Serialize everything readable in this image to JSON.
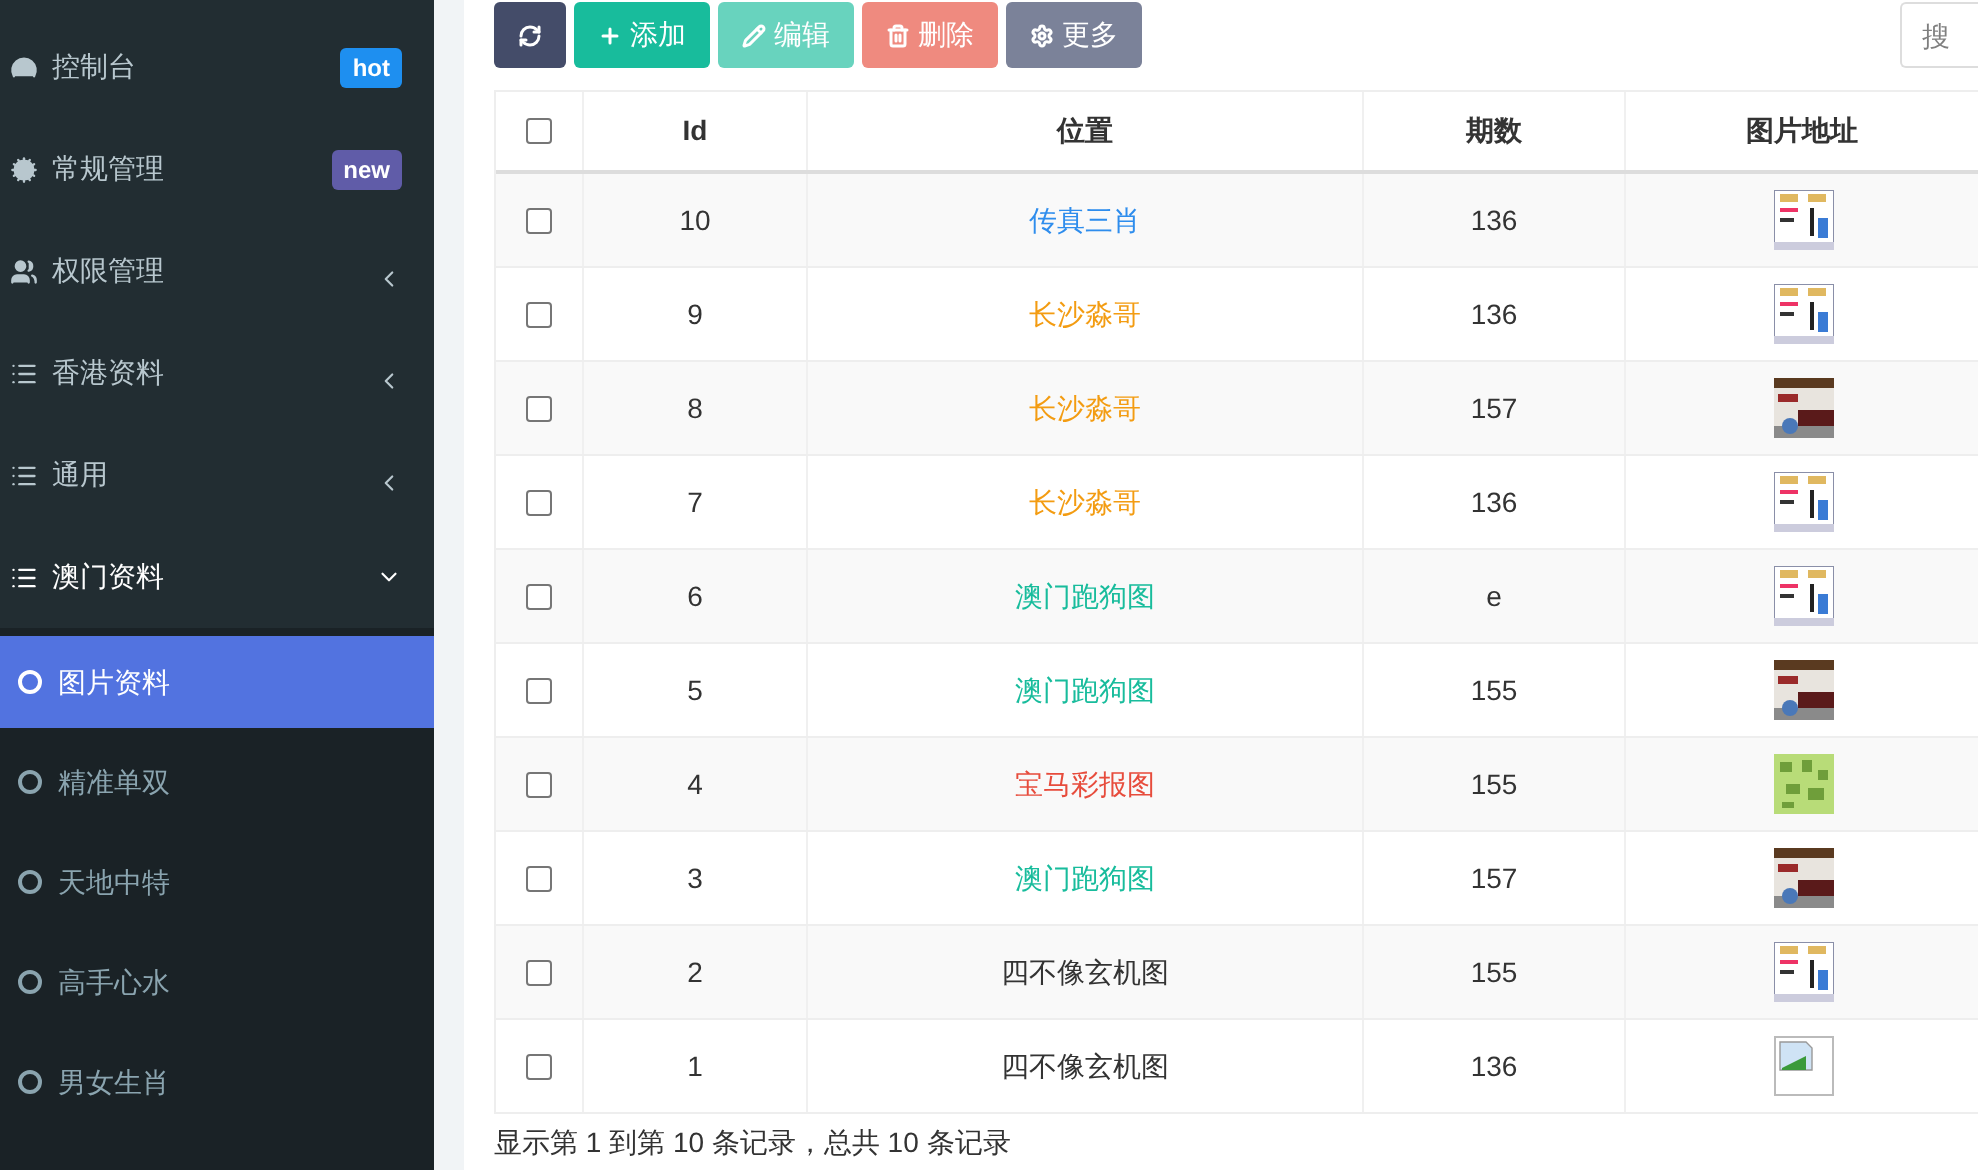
{
  "sidebar": {
    "items": [
      {
        "label": "控制台",
        "kind": "gauge",
        "badge": {
          "text": "hot",
          "color": "#1e8ff0"
        },
        "expanded": false
      },
      {
        "label": "常规管理",
        "kind": "cogs",
        "badge": {
          "text": "new",
          "color": "#605ca8"
        },
        "expanded": false
      },
      {
        "label": "权限管理",
        "kind": "users",
        "has_children": true,
        "expanded": false
      },
      {
        "label": "香港资料",
        "kind": "list",
        "has_children": true,
        "expanded": false
      },
      {
        "label": "通用",
        "kind": "list",
        "has_children": true,
        "expanded": false
      },
      {
        "label": "澳门资料",
        "kind": "list",
        "has_children": true,
        "expanded": true,
        "children": [
          {
            "label": "图片资料",
            "selected": true
          },
          {
            "label": "精准单双",
            "selected": false
          },
          {
            "label": "天地中特",
            "selected": false
          },
          {
            "label": "高手心水",
            "selected": false
          },
          {
            "label": "男女生肖",
            "selected": false
          }
        ]
      }
    ]
  },
  "toolbar": {
    "buttons": [
      {
        "kind": "refresh",
        "disabled": false
      },
      {
        "kind": "add",
        "label": "添加",
        "disabled": false
      },
      {
        "kind": "edit",
        "label": "编辑",
        "disabled": true
      },
      {
        "kind": "delete",
        "label": "删除",
        "disabled": true
      },
      {
        "kind": "more",
        "label": "更多",
        "disabled": false
      }
    ],
    "search": {
      "placeholder": "搜"
    }
  },
  "table": {
    "all_checked": false,
    "columns": [
      "Id",
      "位置",
      "期数",
      "图片地址"
    ],
    "rows": [
      {
        "checked": false,
        "id": "10",
        "location": "传真三肖",
        "color": "#2e8ded",
        "issue": "136",
        "kind": "book"
      },
      {
        "checked": false,
        "id": "9",
        "location": "长沙淼哥",
        "color": "#f39c12",
        "issue": "136",
        "kind": "book"
      },
      {
        "checked": false,
        "id": "8",
        "location": "长沙淼哥",
        "color": "#f39c12",
        "issue": "157",
        "kind": "scene"
      },
      {
        "checked": false,
        "id": "7",
        "location": "长沙淼哥",
        "color": "#f39c12",
        "issue": "136",
        "kind": "book"
      },
      {
        "checked": false,
        "id": "6",
        "location": "澳门跑狗图",
        "color": "#18bc9c",
        "issue": "e",
        "kind": "book"
      },
      {
        "checked": false,
        "id": "5",
        "location": "澳门跑狗图",
        "color": "#18bc9c",
        "issue": "155",
        "kind": "scene"
      },
      {
        "checked": false,
        "id": "4",
        "location": "宝马彩报图",
        "color": "#e74c3c",
        "issue": "155",
        "kind": "green"
      },
      {
        "checked": false,
        "id": "3",
        "location": "澳门跑狗图",
        "color": "#18bc9c",
        "issue": "157",
        "kind": "scene"
      },
      {
        "checked": false,
        "id": "2",
        "location": "四不像玄机图",
        "color": "#333333",
        "issue": "155",
        "kind": "book"
      },
      {
        "checked": false,
        "id": "1",
        "location": "四不像玄机图",
        "color": "#333333",
        "issue": "136",
        "kind": "broken"
      }
    ]
  },
  "footer": {
    "summary": "显示第 1 到第 10 条记录，总共 10 条记录"
  }
}
